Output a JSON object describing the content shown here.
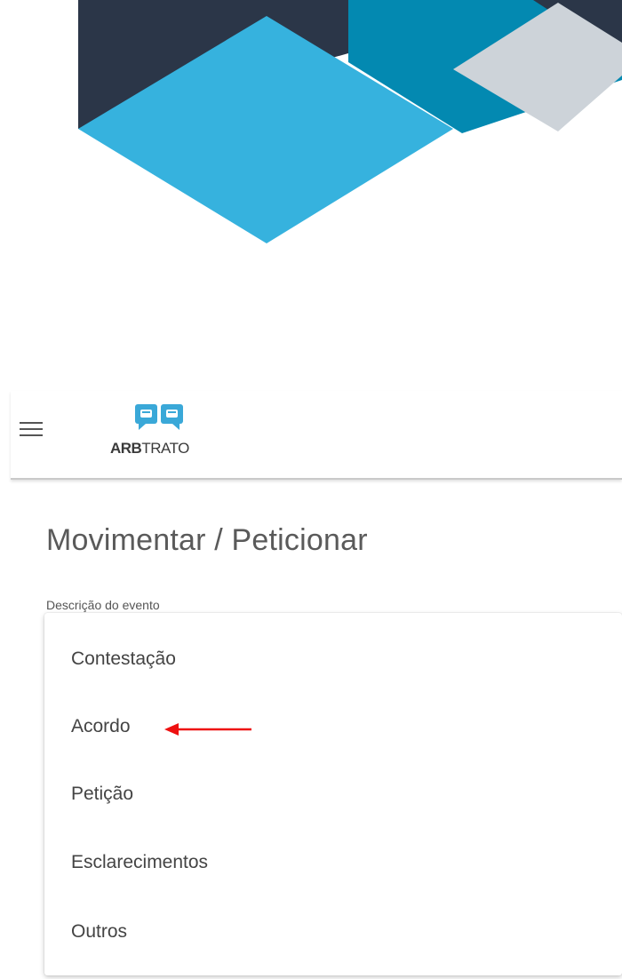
{
  "header": {
    "logo_text_bold": "ARB",
    "logo_text_regular": "TRATO"
  },
  "page": {
    "title": "Movimentar / Peticionar"
  },
  "form": {
    "event_description_label": "Descrição do evento",
    "options": [
      "Contestação",
      "Acordo",
      "Petição",
      "Esclarecimentos",
      "Outros"
    ],
    "highlighted_option": "Acordo"
  },
  "colors": {
    "banner_dark": "#2b3648",
    "banner_teal": "#0389b1",
    "banner_light_blue": "#36b2de",
    "banner_gray": "#cdd3d9",
    "logo_blue": "#3aa8d8",
    "annotation_red": "#ee1111"
  },
  "icons": {
    "menu": "hamburger-menu-icon",
    "annotation": "red-arrow-pointer"
  }
}
